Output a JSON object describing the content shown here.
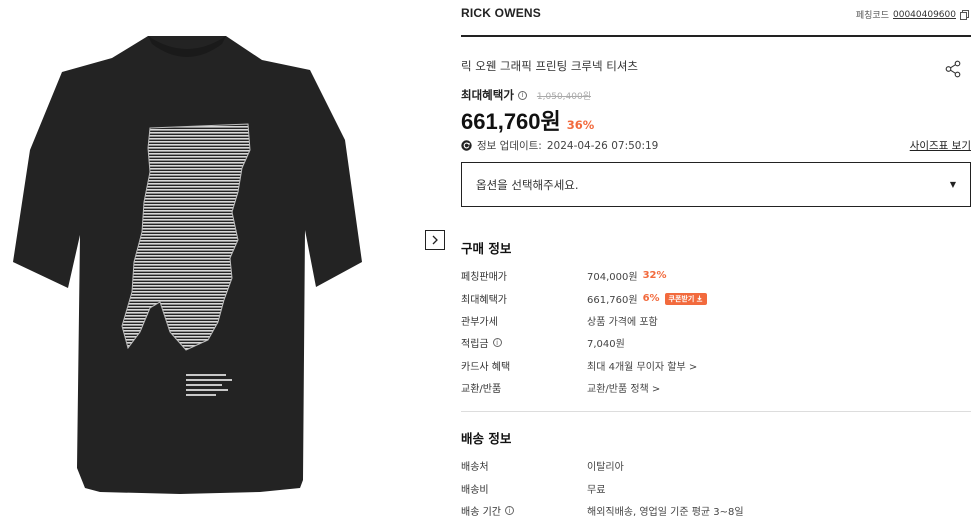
{
  "brand": "RICK OWENS",
  "product_code": {
    "label": "페칭코드",
    "value": "00040409600"
  },
  "product_name": "릭 오웬 그래픽 프린팅 크루넥 티셔츠",
  "benefit": {
    "label": "최대혜택가",
    "original_price": "1,050,400원",
    "price": "661,760원",
    "discount": "36%"
  },
  "update": {
    "label": "정보 업데이트:",
    "datetime": "2024-04-26 07:50:19"
  },
  "size_guide": "사이즈표 보기",
  "option_select": {
    "placeholder": "옵션을 선택해주세요."
  },
  "purchase_info": {
    "title": "구매 정보",
    "rows": [
      {
        "label": "페칭판매가",
        "value": "704,000원",
        "extra": "32%"
      },
      {
        "label": "최대혜택가",
        "value": "661,760원",
        "extra": "6%",
        "badge": "쿠폰받기"
      },
      {
        "label": "관부가세",
        "value": "상품 가격에 포함"
      },
      {
        "label": "적립금",
        "value": "7,040원"
      },
      {
        "label": "카드사 혜택",
        "value": "최대 4개월 무이자 할부 >"
      },
      {
        "label": "교환/반품",
        "value": "교환/반품 정책 >"
      }
    ]
  },
  "shipping_info": {
    "title": "배송 정보",
    "rows": [
      {
        "label": "배송처",
        "value": "이탈리아"
      },
      {
        "label": "배송비",
        "value": "무료"
      },
      {
        "label": "배송 기간",
        "value": "해외직배송, 영업일 기준 평균 3~8일"
      }
    ]
  },
  "colors": {
    "accent": "#f26a3d",
    "shirt": "#232323",
    "text": "#222222"
  },
  "icons": [
    "copy-icon",
    "share-icon",
    "info-icon",
    "refresh-icon",
    "caret-down-icon",
    "chevron-right-icon",
    "download-icon"
  ]
}
